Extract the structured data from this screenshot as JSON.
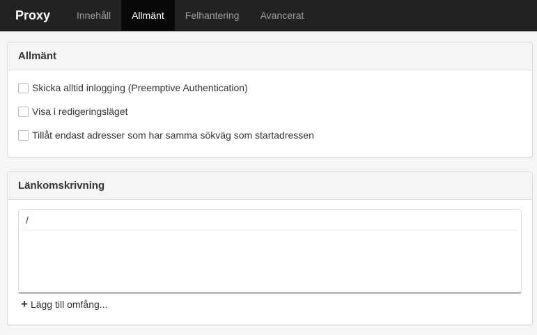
{
  "navbar": {
    "brand": "Proxy",
    "tabs": [
      {
        "label": "Innehåll"
      },
      {
        "label": "Allmänt",
        "active": true
      },
      {
        "label": "Felhantering"
      },
      {
        "label": "Avancerat"
      }
    ]
  },
  "general_panel": {
    "title": "Allmänt",
    "checkboxes": [
      {
        "label": "Skicka alltid inlogging (Preemptive Authentication)",
        "checked": false
      },
      {
        "label": "Visa i redigeringsläget",
        "checked": false
      },
      {
        "label": "Tillåt endast adresser som har samma sökväg som startadressen",
        "checked": false
      }
    ]
  },
  "link_panel": {
    "title": "Länkomskrivning",
    "items": [
      "/"
    ],
    "add_label": "Lägg till omfång..."
  },
  "icons": {
    "add": "plus-icon"
  },
  "colors": {
    "navbar_bg": "#222222",
    "active_tab_bg": "#080808",
    "panel_heading_bg": "#f5f5f5"
  }
}
